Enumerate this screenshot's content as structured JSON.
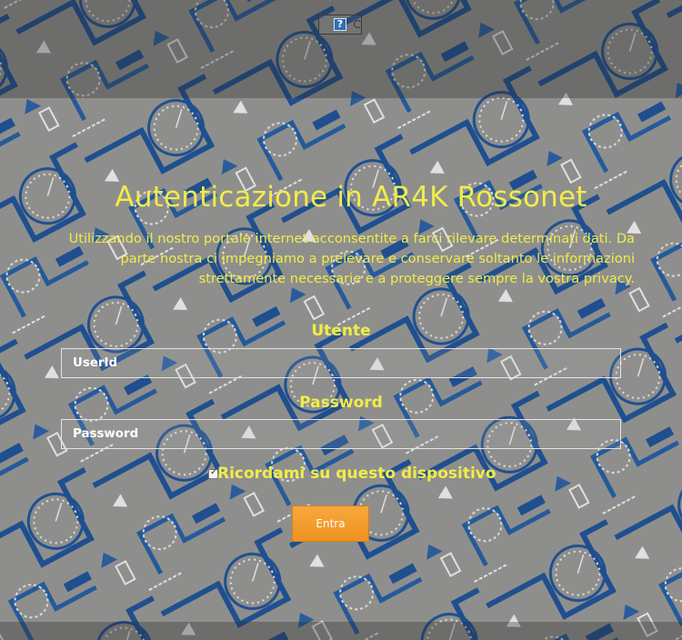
{
  "colors": {
    "accent_text": "#f1ec4a",
    "background": "#8e8f8d",
    "pattern_blue": "#1f4f8f",
    "button": "#f29b2a"
  },
  "header": {
    "help_icon": "help-icon",
    "help_glyph": "?",
    "secondary_icon": "circle-icon"
  },
  "login": {
    "title": "Autenticazione in AR4K Rossonet",
    "intro": "Utilizzando il nostro portale internet acconsentite a farci rilevare determinati dati. Da parte nostra ci impegniamo a prelevare e conservare soltanto le informazioni strettamente necessarie e a proteggere sempre la vostra privacy.",
    "user_label": "Utente",
    "user_placeholder": "UserId",
    "user_value": "",
    "password_label": "Password",
    "password_placeholder": "Password",
    "password_value": "",
    "remember_label": "Ricordami su questo dispositivo",
    "remember_checked": true,
    "submit_label": "Entra"
  }
}
